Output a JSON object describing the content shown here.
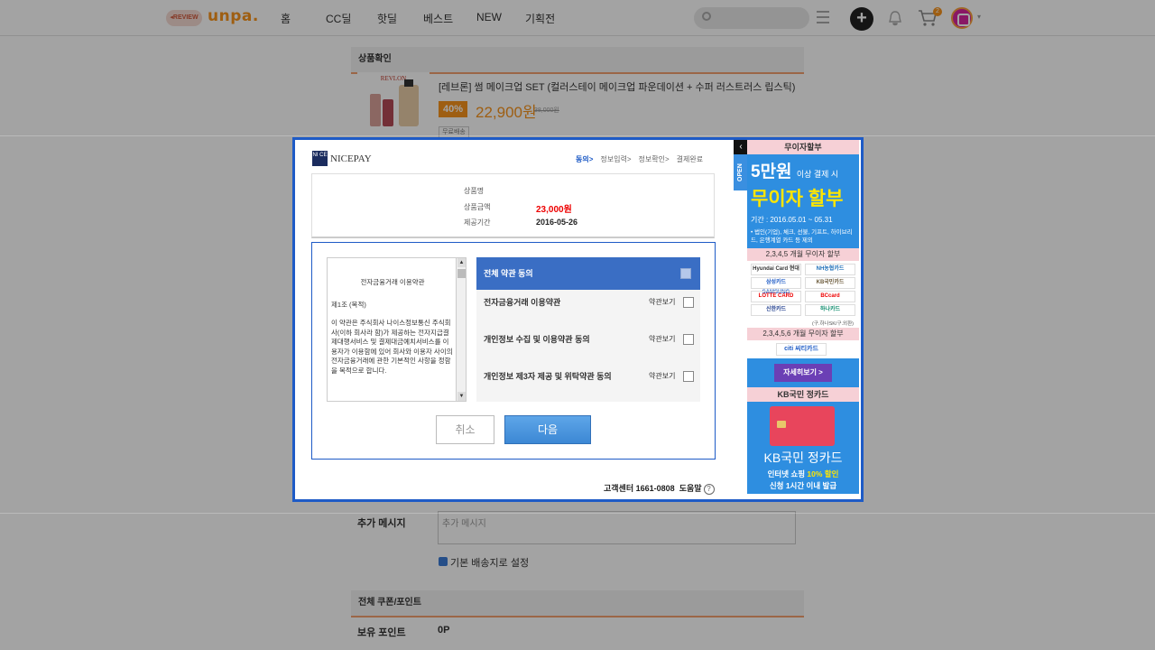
{
  "header": {
    "review_badge": "◂REVIEW",
    "logo": "unpa.",
    "nav": [
      "홈",
      "CC딜",
      "핫딜",
      "베스트",
      "NEW",
      "기획전"
    ],
    "cart_count": "2"
  },
  "order": {
    "section_product": "상품확인",
    "product_name": "[레브론] 썸 메이크업 SET (컬러스테이 메이크업 파운데이션 + 수퍼 러스트러스 립스틱)",
    "product_brand": "REVLON",
    "discount": "40%",
    "price": "22,900원",
    "original_price": "38,000원",
    "shipping": "무료배송",
    "message_label": "추가 메시지",
    "message_placeholder": "추가 메시지",
    "default_address": "기본 배송지로 설정",
    "section_coupon": "전체 쿠폰/포인트",
    "points_label": "보유 포인트",
    "points_value": "0P"
  },
  "modal": {
    "logo_box": "NI CE",
    "logo_text": "NICEPAY",
    "steps": [
      "동의>",
      "정보입력>",
      "정보확인>",
      "결제완료"
    ],
    "info": {
      "name_label": "상품명",
      "amount_label": "상품금액",
      "amount_value": "23,000원",
      "period_label": "제공기간",
      "period_value": "2016-05-26"
    },
    "terms": {
      "title": "전자금융거래 이용약관",
      "article": "제1조 (목적)",
      "body": "이 약관은 주식회사 나이스정보통신 주식회사(이하 회사라 함)가 제공하는 전자지급결제대행서비스 및 결제대금예치서비스를 이용자가 이용함에 있어 회사와 이용자 사이의 전자금융거래에 관한 기본적인 사항을 정함을 목적으로 합니다."
    },
    "agree_all": "전체 약관 동의",
    "agreements": [
      {
        "label": "전자금융거래 이용약관",
        "view": "약관보기"
      },
      {
        "label": "개인정보 수집 및 이용약관 동의",
        "view": "약관보기"
      },
      {
        "label": "개인정보 제3자 제공 및 위탁약관 동의",
        "view": "약관보기"
      }
    ],
    "cancel": "취소",
    "next": "다음",
    "customer_center": "고객센터 1661-0808",
    "help": "도움말",
    "help_icon": "?"
  },
  "ad": {
    "close_icon": "‹",
    "open_tab": "OPEN",
    "head": "무이자할부",
    "amount": "5만원",
    "amount_suffix": "이상 결제 시",
    "headline": "무이자 할부",
    "period": "기간 : 2016.05.01 ~ 05.31",
    "note": "• 법인(기업), 체크, 선불, 기프트, 하이브리드, 은행계열 카드 등 제외",
    "sub1": "2,3,4,5 개월 무이자 할부",
    "cards": [
      "Hyundai Card 현대",
      "NH농협카드",
      "삼성카드 SAMSUNG",
      "KB국민카드",
      "LOTTE CARD",
      "BCcard",
      "신한카드",
      "하나카드"
    ],
    "card_note": "(구.하나SK/구.외환)",
    "sub2": "2,3,4,5,6 개월 무이자 할부",
    "citi": "citi 씨티카드",
    "detail": "자세히보기 >",
    "kb_head": "KB국민 정카드",
    "kb_title": "KB국민 정카드",
    "kb_line1_pre": "인터넷 쇼핑",
    "kb_line1_hl": "10% 할인",
    "kb_line2": "신청 1시간 이내 발급"
  }
}
